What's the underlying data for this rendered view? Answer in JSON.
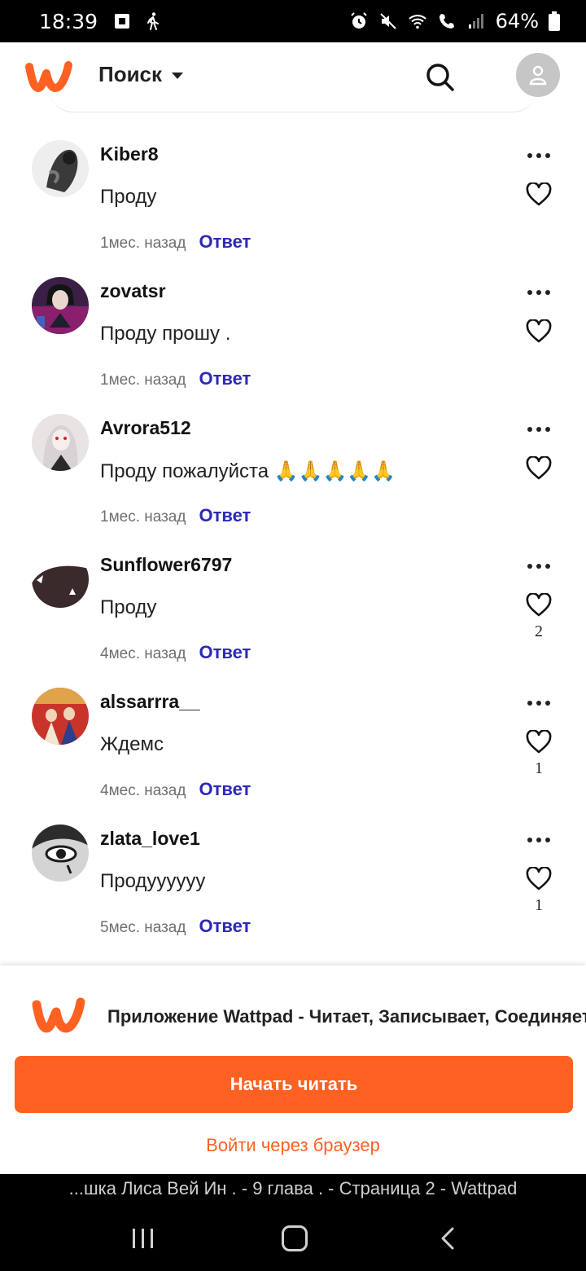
{
  "status_bar": {
    "time": "18:39",
    "battery": "64%"
  },
  "header": {
    "search_label": "Поиск"
  },
  "comments": [
    {
      "user": "Kiber8",
      "text": "Проду",
      "time": "1мес. назад",
      "reply": "Ответ",
      "likes": ""
    },
    {
      "user": "zovatsr",
      "text": "Проду прошу .",
      "time": "1мес. назад",
      "reply": "Ответ",
      "likes": ""
    },
    {
      "user": "Avrora512",
      "text": "Проду пожалуйста 🙏🙏🙏🙏🙏",
      "time": "1мес. назад",
      "reply": "Ответ",
      "likes": ""
    },
    {
      "user": "Sunflower6797",
      "text": "Проду",
      "time": "4мес. назад",
      "reply": "Ответ",
      "likes": "2"
    },
    {
      "user": "alssarrra__",
      "text": "Ждемс",
      "time": "4мес. назад",
      "reply": "Ответ",
      "likes": "1"
    },
    {
      "user": "zlata_love1",
      "text": "Продуууууу",
      "time": "5мес. назад",
      "reply": "Ответ",
      "likes": "1"
    }
  ],
  "sheet": {
    "title": "Приложение Wattpad - Читает, Записывает, Соединяет",
    "start_button": "Начать читать",
    "browser_link": "Войти через браузер"
  },
  "browser": {
    "url_title": "...шка Лиса Вей Ин . - 9 глава . - Страница 2 - Wattpad"
  },
  "colors": {
    "brand": "#ff6122",
    "reply": "#2d29b5"
  }
}
